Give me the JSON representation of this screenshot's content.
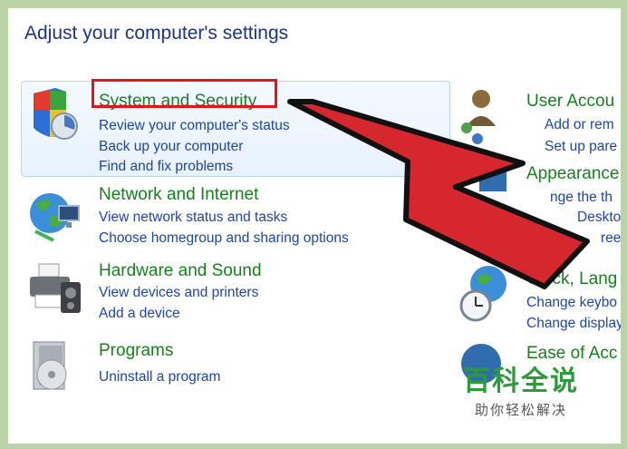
{
  "page": {
    "heading": "Adjust your computer's settings"
  },
  "categories": [
    {
      "title": "System and Security",
      "links": [
        "Review your computer's status",
        "Back up your computer",
        "Find and fix problems"
      ]
    },
    {
      "title": "Network and Internet",
      "links": [
        "View network status and tasks",
        "Choose homegroup and sharing options"
      ]
    },
    {
      "title": "Hardware and Sound",
      "links": [
        "View devices and printers",
        "Add a device"
      ]
    },
    {
      "title": "Programs",
      "links": [
        "Uninstall a program"
      ]
    }
  ],
  "right_categories": [
    {
      "title": "User Accou",
      "links": [
        "Add or rem",
        "Set up pare"
      ]
    },
    {
      "title": "Appearance",
      "links": [
        "nge the th",
        "Desktop",
        "reen re"
      ]
    },
    {
      "title": "Clock, Lang",
      "links": [
        "Change keybo",
        "Change display"
      ]
    },
    {
      "title": "Ease of Acc",
      "links": [
        "",
        "",
        ""
      ]
    }
  ],
  "watermark": {
    "main": "百科全说",
    "sub": "助你轻松解决"
  },
  "colors": {
    "category_title": "#16811d",
    "link": "#1e44a8",
    "highlight": "#e4141c",
    "arrow": "#d7272e"
  },
  "icons": [
    "shield-icon",
    "globe-network-icon",
    "printer-icon",
    "programs-disc-icon",
    "users-icon",
    "appearance-icon",
    "clock-globe-icon",
    "ease-of-access-icon"
  ]
}
